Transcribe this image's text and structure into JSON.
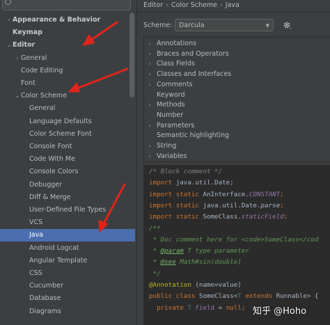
{
  "sidebar": {
    "search_placeholder": "",
    "items": [
      {
        "label": "Appearance & Behavior",
        "arrow": "›",
        "bold": true,
        "indent": 0
      },
      {
        "label": "Keymap",
        "arrow": "",
        "bold": true,
        "indent": 0
      },
      {
        "label": "Editor",
        "arrow": "⌄",
        "bold": true,
        "indent": 0
      },
      {
        "label": "General",
        "arrow": "›",
        "bold": false,
        "indent": 1
      },
      {
        "label": "Code Editing",
        "arrow": "",
        "bold": false,
        "indent": 1
      },
      {
        "label": "Font",
        "arrow": "",
        "bold": false,
        "indent": 1
      },
      {
        "label": "Color Scheme",
        "arrow": "⌄",
        "bold": false,
        "indent": 1
      },
      {
        "label": "General",
        "arrow": "",
        "bold": false,
        "indent": 2
      },
      {
        "label": "Language Defaults",
        "arrow": "",
        "bold": false,
        "indent": 2
      },
      {
        "label": "Color Scheme Font",
        "arrow": "",
        "bold": false,
        "indent": 2
      },
      {
        "label": "Console Font",
        "arrow": "",
        "bold": false,
        "indent": 2
      },
      {
        "label": "Code With Me",
        "arrow": "",
        "bold": false,
        "indent": 2
      },
      {
        "label": "Console Colors",
        "arrow": "",
        "bold": false,
        "indent": 2
      },
      {
        "label": "Debugger",
        "arrow": "",
        "bold": false,
        "indent": 2
      },
      {
        "label": "Diff & Merge",
        "arrow": "",
        "bold": false,
        "indent": 2
      },
      {
        "label": "User-Defined File Types",
        "arrow": "",
        "bold": false,
        "indent": 2
      },
      {
        "label": "VCS",
        "arrow": "",
        "bold": false,
        "indent": 2
      },
      {
        "label": "Java",
        "arrow": "",
        "bold": false,
        "indent": 2,
        "selected": true
      },
      {
        "label": "Android Logcat",
        "arrow": "",
        "bold": false,
        "indent": 2
      },
      {
        "label": "Angular Template",
        "arrow": "",
        "bold": false,
        "indent": 2
      },
      {
        "label": "CSS",
        "arrow": "",
        "bold": false,
        "indent": 2
      },
      {
        "label": "Cucumber",
        "arrow": "",
        "bold": false,
        "indent": 2
      },
      {
        "label": "Database",
        "arrow": "",
        "bold": false,
        "indent": 2
      },
      {
        "label": "Diagrams",
        "arrow": "",
        "bold": false,
        "indent": 2
      }
    ]
  },
  "main": {
    "breadcrumb": [
      "Editor",
      "Color Scheme",
      "Java"
    ],
    "scheme_label": "Scheme:",
    "scheme_value": "Darcula",
    "categories": [
      {
        "label": "Annotations",
        "expandable": true
      },
      {
        "label": "Braces and Operators",
        "expandable": true
      },
      {
        "label": "Class Fields",
        "expandable": true
      },
      {
        "label": "Classes and Interfaces",
        "expandable": true
      },
      {
        "label": "Comments",
        "expandable": true
      },
      {
        "label": "Keyword",
        "expandable": false
      },
      {
        "label": "Methods",
        "expandable": true
      },
      {
        "label": "Number",
        "expandable": false
      },
      {
        "label": "Parameters",
        "expandable": true
      },
      {
        "label": "Semantic highlighting",
        "expandable": false
      },
      {
        "label": "String",
        "expandable": true
      },
      {
        "label": "Variables",
        "expandable": true
      }
    ],
    "code_lines": [
      [
        {
          "t": "/* Block comment */",
          "c": "cm"
        }
      ],
      [
        {
          "t": "import ",
          "c": "kw"
        },
        {
          "t": "java.util.Date;",
          "c": "pl"
        }
      ],
      [
        {
          "t": "import static ",
          "c": "kw"
        },
        {
          "t": "AnInterface.",
          "c": "pl"
        },
        {
          "t": "CONSTANT",
          "c": "it"
        },
        {
          "t": ";",
          "c": "kw"
        }
      ],
      [
        {
          "t": "import static ",
          "c": "kw"
        },
        {
          "t": "java.util.Date.",
          "c": "pl"
        },
        {
          "t": "parse",
          "c": "fn"
        },
        {
          "t": ";",
          "c": "kw"
        }
      ],
      [
        {
          "t": "import static ",
          "c": "kw"
        },
        {
          "t": "SomeClass.",
          "c": "pl"
        },
        {
          "t": "staticField",
          "c": "it"
        },
        {
          "t": ";",
          "c": "kw"
        }
      ],
      [
        {
          "t": "/**",
          "c": "doc"
        }
      ],
      [
        {
          "t": " * Doc comment here for ",
          "c": "doc"
        },
        {
          "t": "<code>",
          "c": "doc"
        },
        {
          "t": "SomeClass",
          "c": "doc"
        },
        {
          "t": "</cod",
          "c": "doc"
        }
      ],
      [
        {
          "t": " * ",
          "c": "doc"
        },
        {
          "t": "@param",
          "c": "tag"
        },
        {
          "t": " T type parameter",
          "c": "doc"
        }
      ],
      [
        {
          "t": " * ",
          "c": "doc"
        },
        {
          "t": "@see",
          "c": "tag"
        },
        {
          "t": " Math#sin(double)",
          "c": "doc"
        }
      ],
      [
        {
          "t": " */",
          "c": "doc"
        }
      ],
      [
        {
          "t": "@Annotation ",
          "c": "ann"
        },
        {
          "t": "(name=value)",
          "c": "pl"
        }
      ],
      [
        {
          "t": "public class ",
          "c": "kw"
        },
        {
          "t": "SomeClass<",
          "c": "pl"
        },
        {
          "t": "T ",
          "c": "tp"
        },
        {
          "t": "extends ",
          "c": "kw"
        },
        {
          "t": "Runnable> {",
          "c": "pl"
        }
      ],
      [
        {
          "t": "  private ",
          "c": "kw"
        },
        {
          "t": "T ",
          "c": "tp"
        },
        {
          "t": "field",
          "c": "fld"
        },
        {
          "t": " = ",
          "c": "pl"
        },
        {
          "t": "null",
          "c": "kw"
        },
        {
          "t": ";",
          "c": "kw"
        }
      ]
    ]
  },
  "watermark": "知乎 @Hoho",
  "colors": {
    "accent_selected": "#4b6eaf",
    "arrow_red": "#e0241b"
  }
}
